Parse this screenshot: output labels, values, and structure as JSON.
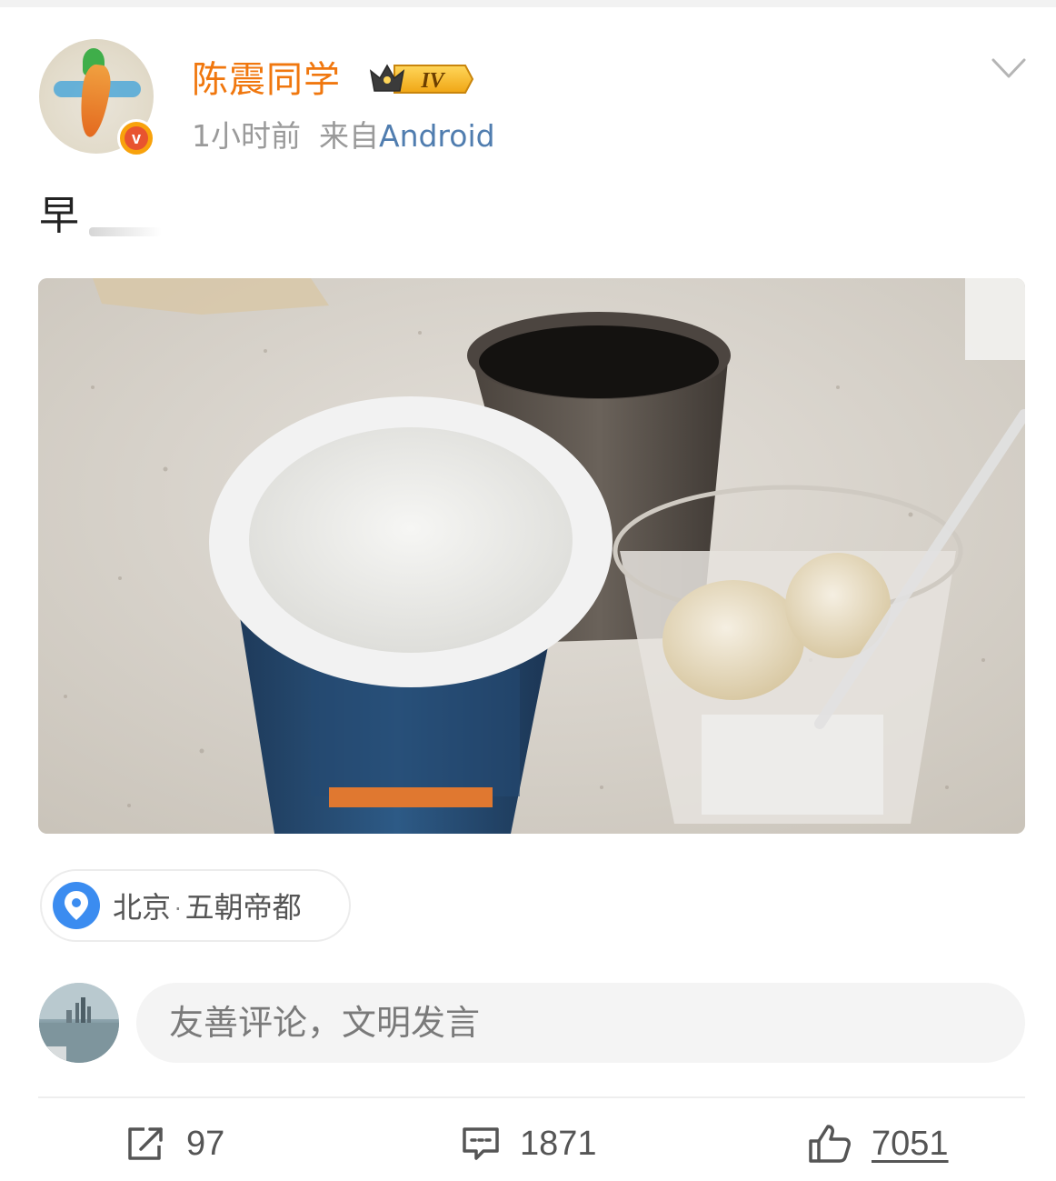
{
  "post": {
    "author": {
      "name": "陈震同学",
      "vip_level": "IV"
    },
    "time": "1小时前",
    "source_prefix": "来自",
    "source_app": "Android",
    "text": "早",
    "location": {
      "city": "北京",
      "separator": "·",
      "description": "五朝帝都"
    }
  },
  "comment_box": {
    "placeholder": "友善评论，文明发言"
  },
  "actions": {
    "repost_count": "97",
    "comment_count": "1871",
    "like_count": "7051"
  },
  "colors": {
    "username": "#f0770e",
    "source_link": "#507daf",
    "location_pin": "#3b8cf0",
    "verified_badge": "#f8a20c"
  },
  "icons": {
    "more": "chevron-down-icon",
    "verified": "verified-v-icon",
    "vip": "crown-vip-icon",
    "location": "location-pin-icon",
    "repost": "share-out-icon",
    "comment": "comment-bubble-icon",
    "like": "thumbs-up-icon"
  }
}
